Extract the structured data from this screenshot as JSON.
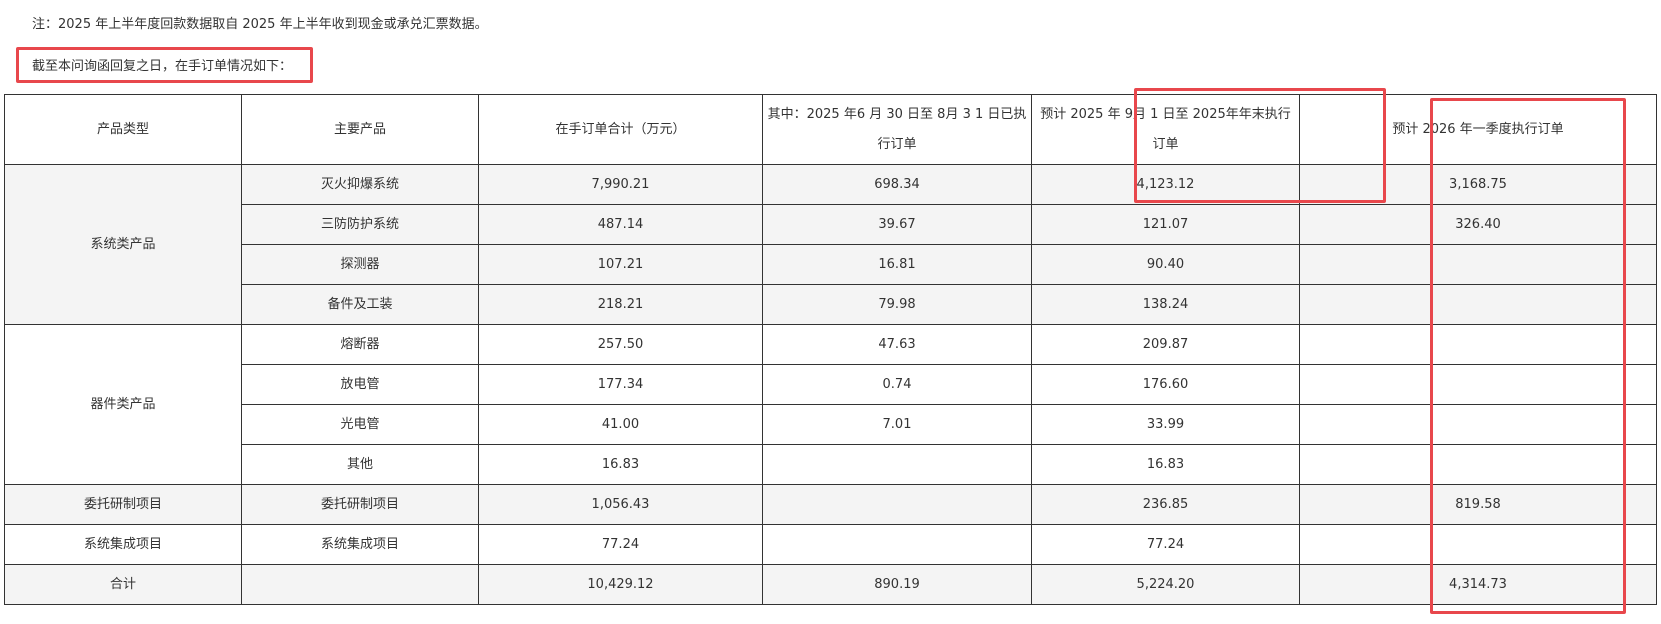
{
  "note": "注：2025 年上半年度回款数据取自 2025 年上半年收到现金或承兑汇票数据。",
  "intro": "截至本问询函回复之日，在手订单情况如下：",
  "table": {
    "headers": [
      "产品类型",
      "主要产品",
      "在手订单合计（万元）",
      "其中：2025 年6 月 30 日至 8月 3 1 日已执行订单",
      "预计 2025 年 9月 1 日至 2025年年末执行订单",
      "预计 2026 年一季度执行订单"
    ],
    "groups": {
      "system": "系统类产品",
      "device": "器件类产品",
      "commission": "委托研制项目",
      "integration": "系统集成项目",
      "total": "合计"
    },
    "rows": [
      {
        "product": "灭火抑爆系统",
        "total": "7,990.21",
        "executed": "698.34",
        "expected_2025": "4,123.12",
        "expected_2026q1": "3,168.75"
      },
      {
        "product": "三防防护系统",
        "total": "487.14",
        "executed": "39.67",
        "expected_2025": "121.07",
        "expected_2026q1": "326.40"
      },
      {
        "product": "探测器",
        "total": "107.21",
        "executed": "16.81",
        "expected_2025": "90.40",
        "expected_2026q1": ""
      },
      {
        "product": "备件及工装",
        "total": "218.21",
        "executed": "79.98",
        "expected_2025": "138.24",
        "expected_2026q1": ""
      },
      {
        "product": "熔断器",
        "total": "257.50",
        "executed": "47.63",
        "expected_2025": "209.87",
        "expected_2026q1": ""
      },
      {
        "product": "放电管",
        "total": "177.34",
        "executed": "0.74",
        "expected_2025": "176.60",
        "expected_2026q1": ""
      },
      {
        "product": "光电管",
        "total": "41.00",
        "executed": "7.01",
        "expected_2025": "33.99",
        "expected_2026q1": ""
      },
      {
        "product": "其他",
        "total": "16.83",
        "executed": "",
        "expected_2025": "16.83",
        "expected_2026q1": ""
      },
      {
        "product": "委托研制项目",
        "total": "1,056.43",
        "executed": "",
        "expected_2025": "236.85",
        "expected_2026q1": "819.58"
      },
      {
        "product": "系统集成项目",
        "total": "77.24",
        "executed": "",
        "expected_2025": "77.24",
        "expected_2026q1": ""
      },
      {
        "product": "",
        "total": "10,429.12",
        "executed": "890.19",
        "expected_2025": "5,224.20",
        "expected_2026q1": "4,314.73"
      }
    ]
  },
  "colors": {
    "highlight": "#e8474c",
    "shade": "#f4f4f4",
    "border": "#333333"
  }
}
